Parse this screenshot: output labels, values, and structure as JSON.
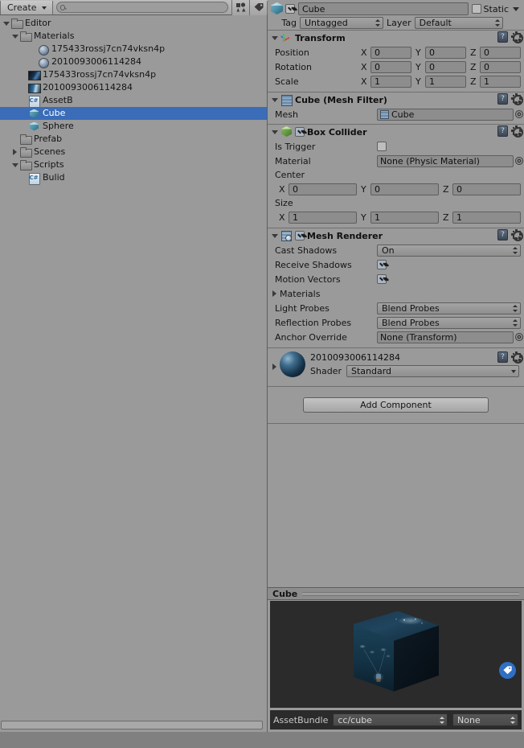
{
  "project_panel": {
    "toolbar": {
      "create_label": "Create",
      "create_caret": "caret-down-icon",
      "search_placeholder": "",
      "search_value": "",
      "search_icon": "search-icon",
      "filter_type_icon": "filter-by-type-icon",
      "filter_label_icon": "filter-by-label-icon"
    },
    "tree": [
      {
        "label": "Editor",
        "icon": "folder-icon",
        "depth": 0,
        "expanded": true,
        "selected": false
      },
      {
        "label": "Materials",
        "icon": "folder-icon",
        "depth": 1,
        "expanded": true,
        "selected": false
      },
      {
        "label": "175433rossj7cn74vksn4p",
        "icon": "material-sphere-icon",
        "depth": 3,
        "expanded": null,
        "selected": false
      },
      {
        "label": "2010093006114284",
        "icon": "material-sphere-icon",
        "depth": 3,
        "expanded": null,
        "selected": false
      },
      {
        "label": "175433rossj7cn74vksn4p",
        "icon": "texture-icon",
        "depth": 2,
        "expanded": null,
        "selected": false
      },
      {
        "label": "2010093006114284",
        "icon": "texture-icon",
        "depth": 2,
        "expanded": null,
        "selected": false
      },
      {
        "label": "AssetB",
        "icon": "csharp-script-icon",
        "depth": 2,
        "expanded": null,
        "selected": false
      },
      {
        "label": "Cube",
        "icon": "prefab-cube-icon",
        "depth": 2,
        "expanded": null,
        "selected": true
      },
      {
        "label": "Sphere",
        "icon": "prefab-cube-icon",
        "depth": 2,
        "expanded": null,
        "selected": false
      },
      {
        "label": "Prefab",
        "icon": "folder-icon",
        "depth": 1,
        "expanded": null,
        "selected": false
      },
      {
        "label": "Scenes",
        "icon": "folder-icon",
        "depth": 1,
        "expanded": false,
        "selected": false
      },
      {
        "label": "Scripts",
        "icon": "folder-icon",
        "depth": 1,
        "expanded": true,
        "selected": false
      },
      {
        "label": "Bulid",
        "icon": "csharp-script-icon",
        "depth": 2,
        "expanded": null,
        "selected": false
      }
    ]
  },
  "inspector": {
    "object": {
      "enabled": true,
      "name": "Cube",
      "static_label": "Static",
      "static_checked": false,
      "tag_label": "Tag",
      "tag_value": "Untagged",
      "layer_label": "Layer",
      "layer_value": "Default"
    },
    "transform": {
      "title": "Transform",
      "expanded": true,
      "rows": [
        {
          "label": "Position",
          "x": "0",
          "y": "0",
          "z": "0"
        },
        {
          "label": "Rotation",
          "x": "0",
          "y": "0",
          "z": "0"
        },
        {
          "label": "Scale",
          "x": "1",
          "y": "1",
          "z": "1"
        }
      ],
      "axis_labels": {
        "x": "X",
        "y": "Y",
        "z": "Z"
      }
    },
    "mesh_filter": {
      "title": "Cube (Mesh Filter)",
      "expanded": true,
      "mesh_label": "Mesh",
      "mesh_value": "Cube"
    },
    "box_collider": {
      "title": "Box Collider",
      "expanded": true,
      "enabled": true,
      "is_trigger_label": "Is Trigger",
      "is_trigger_checked": false,
      "material_label": "Material",
      "material_value": "None (Physic Material)",
      "center_label": "Center",
      "center": {
        "x": "0",
        "y": "0",
        "z": "0"
      },
      "size_label": "Size",
      "size": {
        "x": "1",
        "y": "1",
        "z": "1"
      }
    },
    "mesh_renderer": {
      "title": "Mesh Renderer",
      "expanded": true,
      "enabled": true,
      "cast_shadows_label": "Cast Shadows",
      "cast_shadows_value": "On",
      "receive_shadows_label": "Receive Shadows",
      "receive_shadows_checked": true,
      "motion_vectors_label": "Motion Vectors",
      "motion_vectors_checked": true,
      "materials_label": "Materials",
      "materials_expanded": false,
      "light_probes_label": "Light Probes",
      "light_probes_value": "Blend Probes",
      "reflection_probes_label": "Reflection Probes",
      "reflection_probes_value": "Blend Probes",
      "anchor_override_label": "Anchor Override",
      "anchor_override_value": "None (Transform)"
    },
    "material": {
      "name": "2010093006114284",
      "shader_label": "Shader",
      "shader_value": "Standard",
      "expanded": false
    },
    "add_component_label": "Add Component"
  },
  "preview": {
    "title": "Cube",
    "assetbundle_label": "AssetBundle",
    "assetbundle_value": "cc/cube",
    "assetbundle_variant": "None",
    "badge_icon": "label-tag-icon"
  },
  "colors": {
    "selection": "#3a6cb8",
    "panel_bg": "#9a9a9a",
    "window_bg": "#808080",
    "preview_bg": "#2b2b2b",
    "badge": "#2f6fc4"
  }
}
